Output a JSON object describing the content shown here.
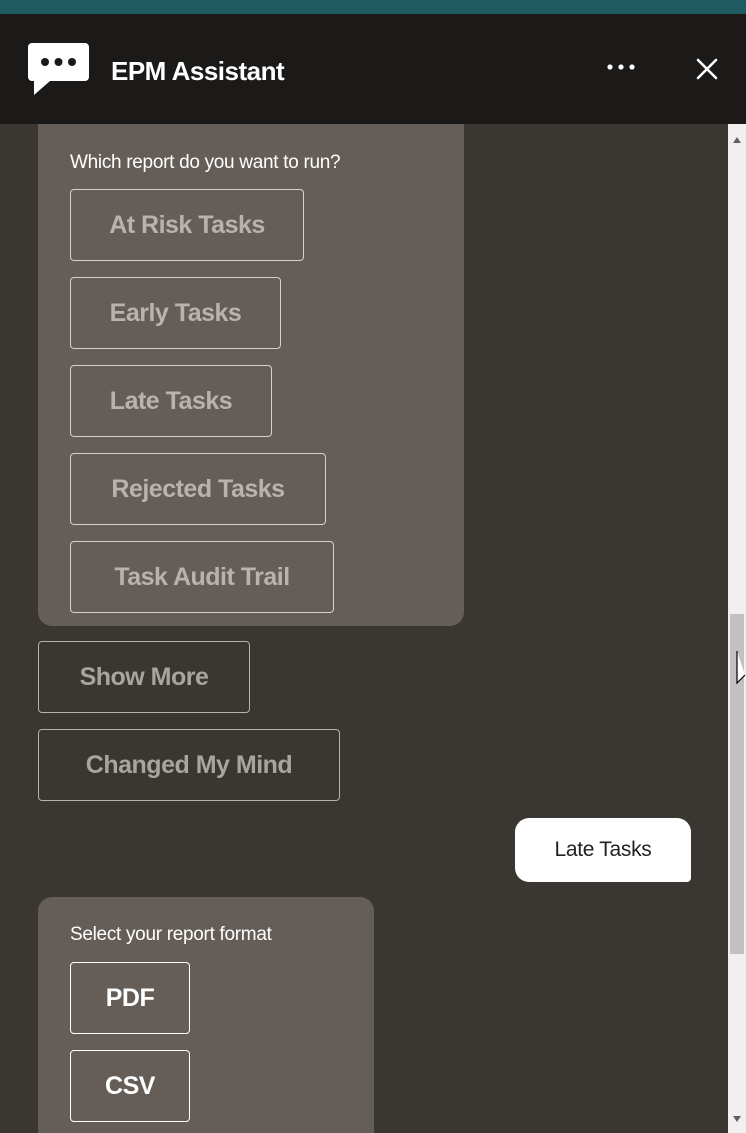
{
  "header": {
    "title": "EPM Assistant",
    "more_icon": "more-horizontal-icon",
    "close_icon": "close-icon",
    "logo_icon": "chat-bubble-icon"
  },
  "messages": {
    "report_prompt": {
      "text": "Which report do you want to run?",
      "options": [
        "At Risk Tasks",
        "Early Tasks",
        "Late Tasks",
        "Rejected Tasks",
        "Task Audit Trail"
      ]
    },
    "actions": {
      "show_more": "Show More",
      "changed_mind": "Changed My Mind"
    },
    "user_reply": "Late Tasks",
    "format_prompt": {
      "text": "Select your report format",
      "options": [
        "PDF",
        "CSV"
      ]
    }
  },
  "colors": {
    "header_bg": "#1c1a18",
    "chat_bg": "#3a3632",
    "bubble_bg": "#655e58",
    "accent_strip": "#1f5a62"
  }
}
